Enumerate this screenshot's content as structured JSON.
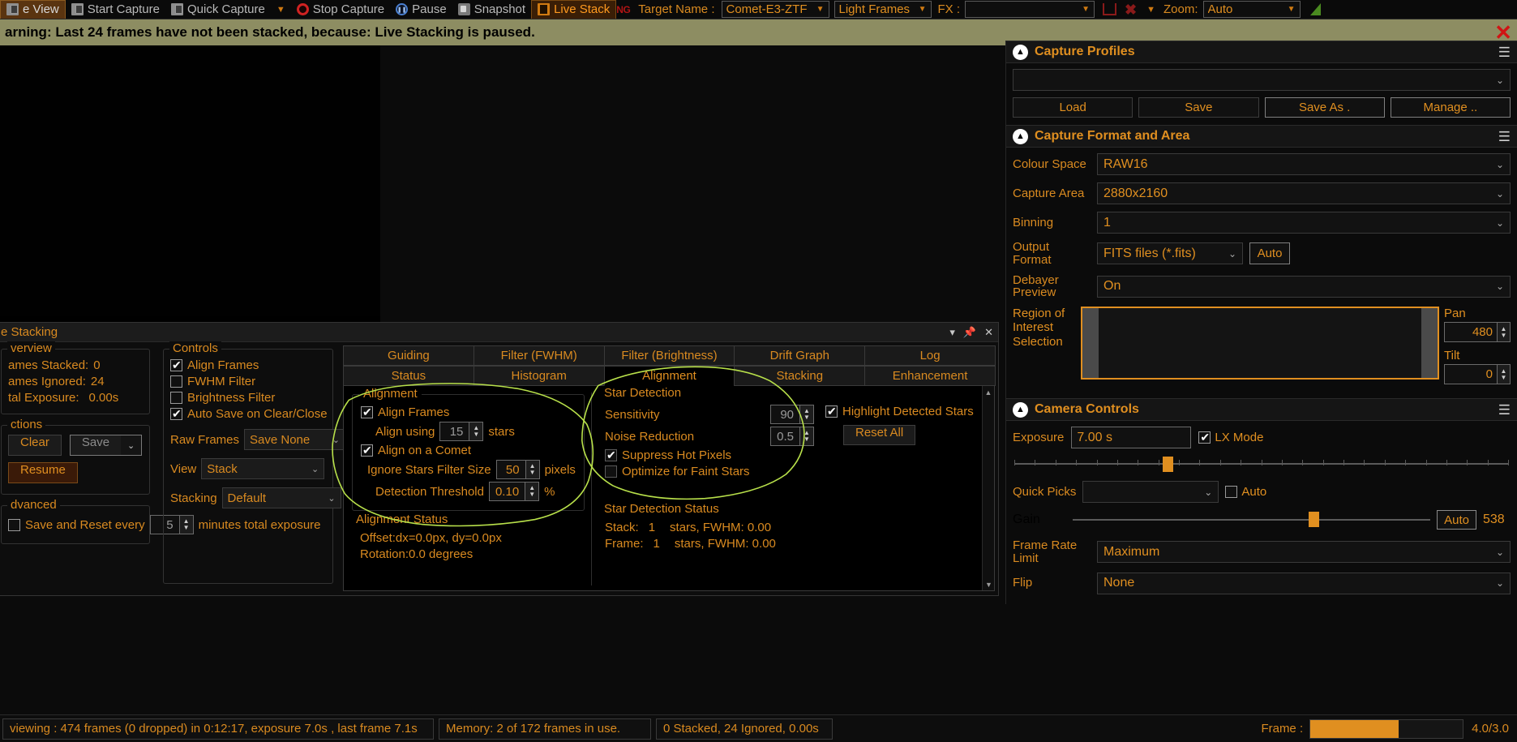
{
  "toolbar": {
    "items": [
      {
        "label": "e View",
        "icon": "view-icon",
        "style": "leftcut"
      },
      {
        "label": "Start Capture",
        "icon": "camera-icon",
        "style": "plain"
      },
      {
        "label": "Quick Capture",
        "icon": "camera-icon",
        "style": "plain"
      },
      {
        "label": "",
        "icon": "chevron-down-icon",
        "style": "caret"
      },
      {
        "label": "Stop Capture",
        "icon": "stop-icon",
        "style": "plain"
      },
      {
        "label": "Pause",
        "icon": "pause-icon",
        "style": "plain"
      },
      {
        "label": "Snapshot",
        "icon": "snapshot-icon",
        "style": "plain"
      },
      {
        "label": "Live Stack",
        "icon": "live-stack-icon",
        "style": "active"
      }
    ],
    "ng_badge": "NG",
    "target_name_label": "Target Name :",
    "target_name_value": "Comet-E3-ZTF",
    "frame_type_value": "Light Frames",
    "fx_label": "FX :",
    "fx_value": "",
    "zoom_label": "Zoom:",
    "zoom_value": "Auto"
  },
  "warning": {
    "text": "arning: Last 24 frames have not been stacked, because: Live Stacking is paused.",
    "close": "✕"
  },
  "live_stacking": {
    "title": "e Stacking",
    "window_buttons": [
      "▾",
      "📌",
      "✕"
    ],
    "overview": {
      "legend": "verview",
      "rows": [
        {
          "label": "ames Stacked:",
          "value": "0"
        },
        {
          "label": "ames Ignored:",
          "value": "24"
        },
        {
          "label": "tal Exposure:",
          "value": "0.00s"
        }
      ]
    },
    "actions": {
      "legend": "ctions",
      "clear": "Clear",
      "save": "Save",
      "save_arrow": "⌄",
      "resume": "Resume"
    },
    "advanced": {
      "legend": "dvanced",
      "save_reset_label": "Save and Reset every",
      "save_reset_value": "5",
      "save_reset_suffix": "minutes total exposure",
      "checked": false
    },
    "controls": {
      "legend": "Controls",
      "align_frames": {
        "label": "Align Frames",
        "checked": true
      },
      "fwhm_filter": {
        "label": "FWHM Filter",
        "checked": false
      },
      "brightness_filter": {
        "label": "Brightness Filter",
        "checked": false
      },
      "auto_save": {
        "label": "Auto Save on Clear/Close",
        "checked": true
      },
      "raw_frames_label": "Raw Frames",
      "raw_frames_value": "Save None",
      "view_label": "View",
      "view_value": "Stack",
      "stacking_label": "Stacking",
      "stacking_value": "Default"
    }
  },
  "tabs": {
    "row_top": [
      "Guiding",
      "Filter (FWHM)",
      "Filter (Brightness)",
      "Drift Graph",
      "Log"
    ],
    "row_bottom": [
      "Status",
      "Histogram",
      "Alignment",
      "Stacking",
      "Enhancement"
    ],
    "selected": "Alignment"
  },
  "alignment_panel": {
    "alignment": {
      "legend": "Alignment",
      "align_frames": {
        "label": "Align Frames",
        "checked": true
      },
      "align_using_label": "Align using",
      "align_using_value": "15",
      "align_using_suffix": "stars",
      "align_comet": {
        "label": "Align on a Comet",
        "checked": true
      },
      "ignore_stars_label": "Ignore Stars Filter Size",
      "ignore_stars_value": "50",
      "ignore_stars_suffix": "pixels",
      "detection_threshold_label": "Detection Threshold",
      "detection_threshold_value": "0.10",
      "detection_threshold_suffix": "%"
    },
    "alignment_status": {
      "legend": "Alignment Status",
      "offset": "Offset:dx=0.0px, dy=0.0px",
      "rotation": "Rotation:0.0 degrees"
    },
    "star_detection": {
      "legend": "Star Detection",
      "sensitivity_label": "Sensitivity",
      "sensitivity_value": "90",
      "noise_reduction_label": "Noise Reduction",
      "noise_reduction_value": "0.5",
      "highlight_stars": {
        "label": "Highlight Detected Stars",
        "checked": true
      },
      "reset_all": "Reset All",
      "suppress_hot_pixels": {
        "label": "Suppress Hot Pixels",
        "checked": true
      },
      "optimize_faint": {
        "label": "Optimize for Faint Stars",
        "checked": false
      }
    },
    "star_detection_status": {
      "legend": "Star Detection Status",
      "stack_label": "Stack:",
      "stack_count": "1",
      "stack_text": "stars, FWHM: 0.00",
      "frame_label": "Frame:",
      "frame_count": "1",
      "frame_text": "stars, FWHM: 0.00"
    }
  },
  "sidebar": {
    "capture_profiles": {
      "title": "Capture Profiles",
      "profile_value": "",
      "buttons": [
        "Load",
        "Save",
        "Save As .",
        "Manage .."
      ]
    },
    "capture_format": {
      "title": "Capture Format and Area",
      "rows": [
        {
          "label": "Colour Space",
          "value": "RAW16"
        },
        {
          "label": "Capture Area",
          "value": "2880x2160"
        },
        {
          "label": "Binning",
          "value": "1"
        },
        {
          "label": "Output Format",
          "value": "FITS files (*.fits)",
          "extra": "Auto"
        },
        {
          "label": "Debayer Preview",
          "value": "On"
        }
      ],
      "roi_label": "Region of Interest Selection",
      "pan_label": "Pan",
      "pan_value": "480",
      "tilt_label": "Tilt",
      "tilt_value": "0"
    },
    "camera_controls": {
      "title": "Camera Controls",
      "exposure_label": "Exposure",
      "exposure_value": "7.00 s",
      "lx_mode": {
        "label": "LX Mode",
        "checked": true
      },
      "quick_picks_label": "Quick Picks",
      "quick_picks_value": "",
      "quick_picks_auto": {
        "label": "Auto",
        "checked": false
      },
      "gain_label": "Gain",
      "gain_auto": "Auto",
      "gain_value": "538",
      "frame_rate_label": "Frame Rate Limit",
      "frame_rate_value": "Maximum",
      "flip_label": "Flip",
      "flip_value": "None"
    }
  },
  "statusbar": {
    "cells": [
      "viewing : 474 frames (0 dropped) in 0:12:17, exposure 7.0s , last frame 7.1s",
      "Memory: 2 of 172 frames in use.",
      "0 Stacked, 24 Ignored, 0.00s"
    ],
    "frame_label": "Frame :",
    "frame_ratio": "4.0/3.0"
  }
}
